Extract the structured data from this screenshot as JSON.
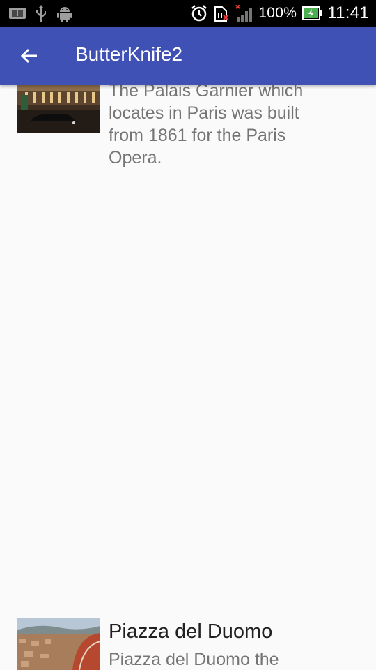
{
  "status_bar": {
    "battery_percent": "100%",
    "time": "11:41",
    "icons": [
      "notification-icon",
      "usb-icon",
      "android-debug-icon",
      "alarm-icon",
      "sim-missing-icon",
      "signal-icon",
      "battery-icon"
    ]
  },
  "app_bar": {
    "title": "ButterKnife2",
    "back_icon": "arrow-back-icon",
    "color": "#3f51b5"
  },
  "list": {
    "items": [
      {
        "title": "",
        "description": "The Palais Garnier which locates in Paris was built from 1861 for the Paris Opera."
      },
      {
        "title": "Piazza del Duomo",
        "description": "Piazza del Duomo the"
      }
    ]
  }
}
